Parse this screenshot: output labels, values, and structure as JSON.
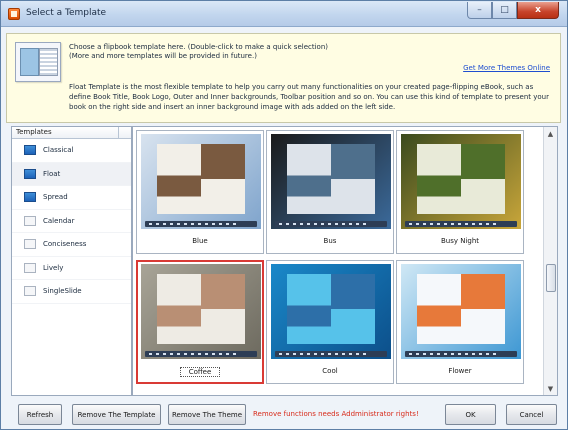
{
  "window": {
    "title": "Select a Template",
    "controls": {
      "minimize": "–",
      "maximize": "□",
      "close": "x"
    }
  },
  "info": {
    "line1": "Choose a flipbook template here. (Double-click to make a quick selection)",
    "line2": "(More and more templates will be provided in future.)",
    "link": "Get More Themes Online",
    "description": "Float Template is the most flexible template to help you carry out many functionalities on your created page-flipping eBook, such as define Book Title, Book Logo, Outer and Inner backgrounds, Toolbar position and so on. You can use this kind of template to present your book on the right side and insert an inner background image with ads added on the left side."
  },
  "templates_panel": {
    "header": "Templates",
    "items": [
      {
        "label": "Classical",
        "icon": "classical-template-icon",
        "selected": false
      },
      {
        "label": "Float",
        "icon": "float-template-icon",
        "selected": true
      },
      {
        "label": "Spread",
        "icon": "spread-template-icon",
        "selected": false
      },
      {
        "label": "Calendar",
        "icon": "calendar-template-icon",
        "selected": false
      },
      {
        "label": "Conciseness",
        "icon": "conciseness-template-icon",
        "selected": false
      },
      {
        "label": "Lively",
        "icon": "lively-template-icon",
        "selected": false
      },
      {
        "label": "SingleSlide",
        "icon": "singleslide-template-icon",
        "selected": false
      }
    ]
  },
  "thumbnails": [
    {
      "label": "Blue",
      "selected": false,
      "colors": {
        "bg": "#d8e3ef",
        "accent": "#7fa4cc",
        "page": "#f2efe8",
        "pic": "#7a5a40"
      }
    },
    {
      "label": "Bus",
      "selected": false,
      "colors": {
        "bg": "#1a1a1a",
        "accent": "#3b6a9b",
        "page": "#dde3ea",
        "pic": "#4e6f8c"
      }
    },
    {
      "label": "Busy Night",
      "selected": false,
      "colors": {
        "bg": "#3a4a1e",
        "accent": "#c9a63a",
        "page": "#e8ead8",
        "pic": "#4f6f2a"
      }
    },
    {
      "label": "Coffee",
      "selected": true,
      "colors": {
        "bg": "#a8a497",
        "accent": "#6d6a5f",
        "page": "#eeebe4",
        "pic": "#b98f74"
      }
    },
    {
      "label": "Cool",
      "selected": false,
      "colors": {
        "bg": "#1a88c9",
        "accent": "#0c4f8a",
        "page": "#56c2ea",
        "pic": "#2d6fa8"
      }
    },
    {
      "label": "Flower",
      "selected": false,
      "colors": {
        "bg": "#d0e8f5",
        "accent": "#3d97d3",
        "page": "#f5f8fb",
        "pic": "#e7793a"
      }
    }
  ],
  "buttons": {
    "refresh": "Refresh",
    "remove_template": "Remove The Template",
    "remove_theme": "Remove The Theme",
    "ok": "OK",
    "cancel": "Cancel"
  },
  "warning": "Remove functions needs Addministrator rights!"
}
